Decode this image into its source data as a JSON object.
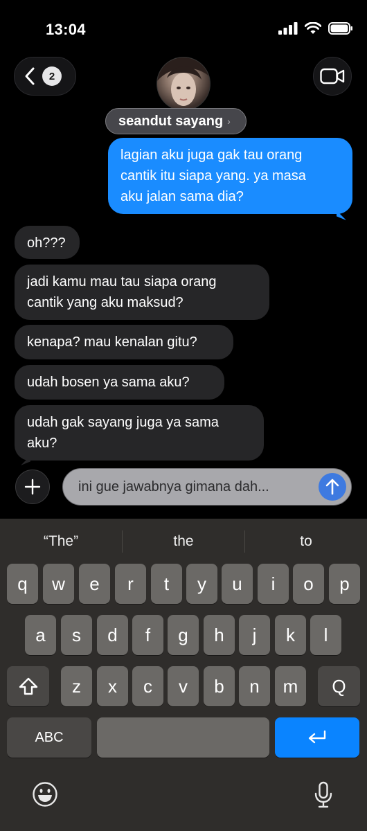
{
  "status_bar": {
    "time": "13:04"
  },
  "header": {
    "back_badge_count": "2",
    "contact_name": "seandut sayang",
    "contact_chevron": "›"
  },
  "messages": [
    {
      "side": "sent",
      "lines": [
        "lagian aku juga gak tau orang",
        "cantik itu siapa yang. ya masa",
        "aku jalan sama dia?"
      ]
    },
    {
      "side": "received",
      "lines": [
        "oh???"
      ]
    },
    {
      "side": "received",
      "lines": [
        "jadi kamu mau tau siapa orang",
        "cantik yang aku maksud?"
      ]
    },
    {
      "side": "received",
      "lines": [
        "kenapa? mau kenalan gitu?"
      ]
    },
    {
      "side": "received",
      "lines": [
        "udah bosen ya sama aku?"
      ]
    },
    {
      "side": "received",
      "lines": [
        "udah gak sayang juga ya sama",
        "aku?"
      ]
    }
  ],
  "composer": {
    "text": "ini gue jawabnya gimana dah..."
  },
  "keyboard": {
    "suggestions": [
      "“The”",
      "the",
      "to"
    ],
    "row1": [
      "q",
      "w",
      "e",
      "r",
      "t",
      "y",
      "u",
      "i",
      "o",
      "p"
    ],
    "row2": [
      "a",
      "s",
      "d",
      "f",
      "g",
      "h",
      "j",
      "k",
      "l"
    ],
    "row3": [
      "z",
      "x",
      "c",
      "v",
      "b",
      "n",
      "m",
      "Q"
    ],
    "abc_label": "ABC"
  },
  "icons": {
    "back": "chevron-left-icon",
    "video": "video-camera-icon",
    "plus": "plus-icon",
    "send": "arrow-up-icon",
    "shift": "shift-icon",
    "return": "return-icon",
    "emoji": "emoji-icon",
    "mic": "microphone-icon"
  },
  "colors": {
    "sent_bubble": "#1a8cff",
    "received_bubble": "#262628",
    "return_key": "#0a84ff"
  }
}
